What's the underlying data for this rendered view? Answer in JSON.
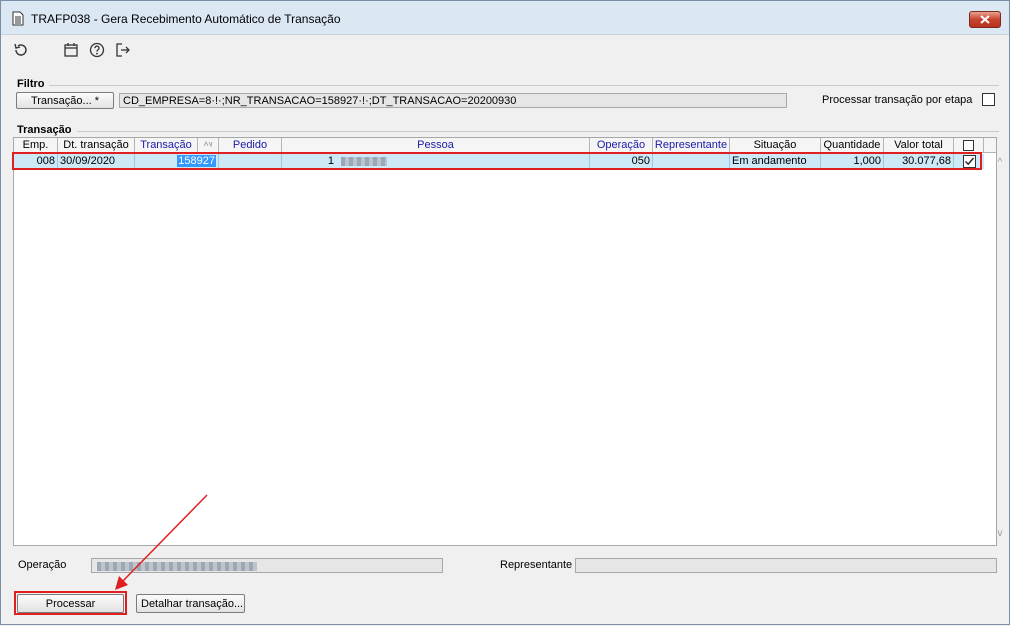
{
  "window": {
    "title": "TRAFP038 - Gera Recebimento Automático de Transação"
  },
  "toolbar": {
    "icons": [
      "refresh-icon",
      "calendar-icon",
      "help-icon",
      "exit-icon"
    ]
  },
  "filtro": {
    "group_label": "Filtro",
    "button_label": "Transação... *",
    "filter_text": "CD_EMPRESA=8·!·;NR_TRANSACAO=158927·!·;DT_TRANSACAO=20200930",
    "process_by_stage_label": "Processar transação por etapa",
    "process_by_stage_checked": false
  },
  "transacao": {
    "group_label": "Transação",
    "columns": [
      "Emp.",
      "Dt. transação",
      "Transação",
      "",
      "Pedido",
      "Pessoa",
      "Operação",
      "Representante",
      "Situação",
      "Quantidade",
      "Valor total"
    ],
    "rows": [
      {
        "emp": "008",
        "dt_transacao": "30/09/2020",
        "transacao": "158927",
        "pedido": "",
        "pessoa_codigo": "1",
        "pessoa_nome": "",
        "operacao": "050",
        "representante": "",
        "situacao": "Em andamento",
        "quantidade": "1,000",
        "valor_total": "30.077,68",
        "checked": true
      }
    ]
  },
  "footer": {
    "operacao_label": "Operação",
    "representante_label": "Representante",
    "processar_label": "Processar",
    "detalhar_label": "Detalhar transação..."
  },
  "colors": {
    "selected_row": "#cde8f7",
    "highlight": "#e02020",
    "link_header": "#1a1aa8"
  }
}
